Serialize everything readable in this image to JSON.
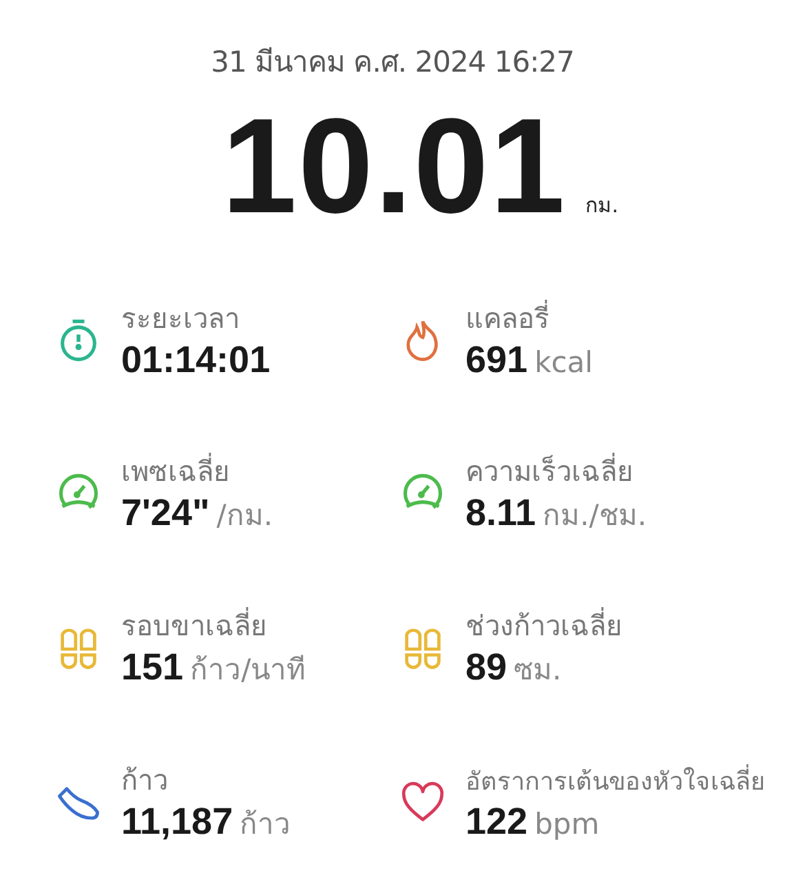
{
  "date": "31 มีนาคม ค.ศ. 2024 16:27",
  "distance": {
    "value": "10.01",
    "unit": "กม."
  },
  "stats": [
    {
      "kind": "stopwatch",
      "label": "ระยะเวลา",
      "value": "01:14:01"
    },
    {
      "kind": "flame",
      "label": "แคลอรี่",
      "value": "691",
      "unit": "kcal"
    },
    {
      "kind": "gauge",
      "label": "เพซเฉลี่ย",
      "value": "7'24\"",
      "unit": "/กม."
    },
    {
      "kind": "speedometer",
      "label": "ความเร็วเฉลี่ย",
      "value": "8.11",
      "unit": "กม./ชม."
    },
    {
      "kind": "footprints",
      "label": "รอบขาเฉลี่ย",
      "value": "151",
      "unit": "ก้าว/นาที"
    },
    {
      "kind": "footprints",
      "label": "ช่วงก้าวเฉลี่ย",
      "value": "89",
      "unit": "ซม."
    },
    {
      "kind": "shoe",
      "label": "ก้าว",
      "value": "11,187",
      "unit": "ก้าว"
    },
    {
      "kind": "heart",
      "label": "อัตราการเต้นของหัวใจเฉลี่ย",
      "value": "122",
      "unit": "bpm"
    }
  ]
}
